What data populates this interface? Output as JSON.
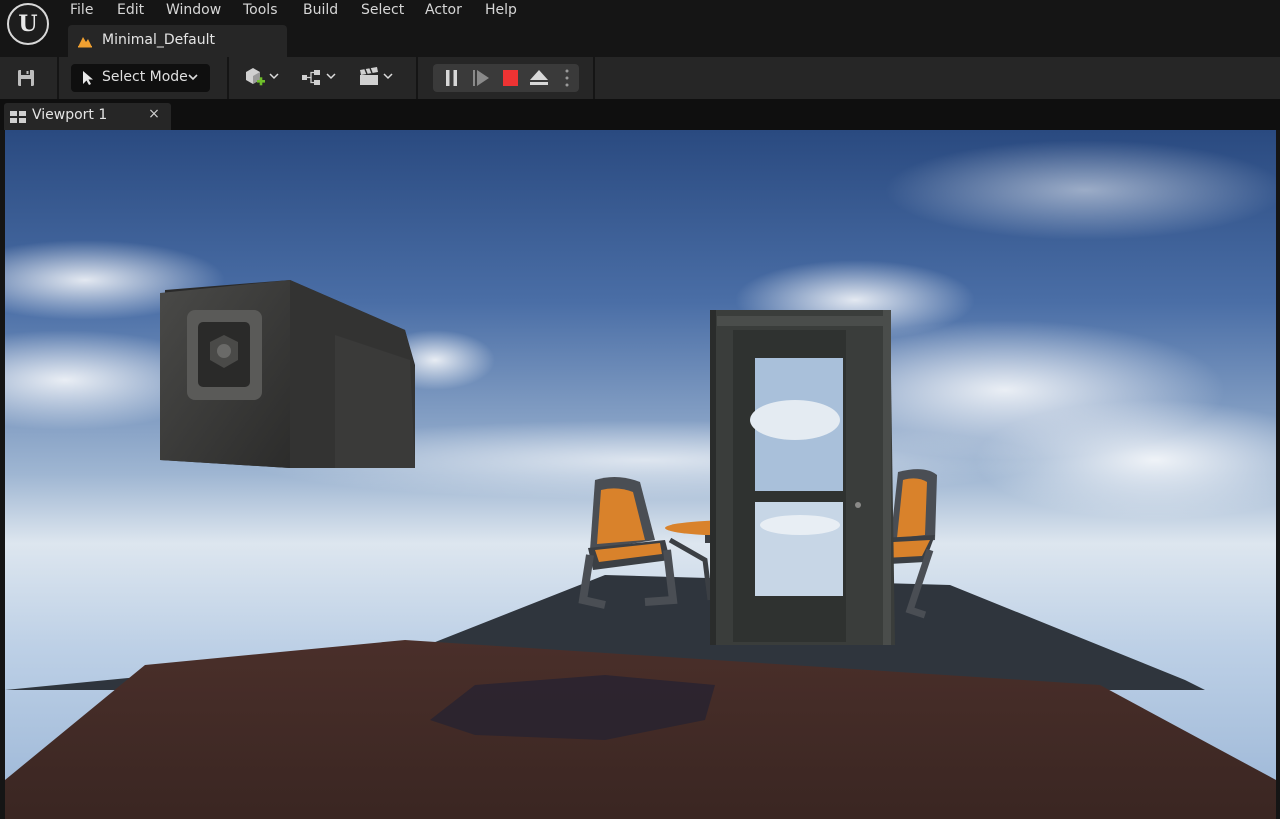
{
  "app": {
    "logo_icon": "unreal-engine-logo-icon",
    "logo_glyph": "U"
  },
  "menu": {
    "items": [
      {
        "label": "File"
      },
      {
        "label": "Edit"
      },
      {
        "label": "Window"
      },
      {
        "label": "Tools"
      },
      {
        "label": "Build"
      },
      {
        "label": "Select"
      },
      {
        "label": "Actor"
      },
      {
        "label": "Help"
      }
    ]
  },
  "document_tab": {
    "label": "Minimal_Default",
    "icon": "level-icon",
    "icon_color": "#f0a030"
  },
  "toolbar": {
    "save_icon": "save-icon",
    "mode_label": "Select Mode",
    "mode_icon": "cursor-icon",
    "add_actor_icon": "add-actor-icon",
    "add_accent_color": "#6fbf2a",
    "blueprints_icon": "blueprint-icon",
    "cinematics_icon": "clapperboard-icon",
    "play_controls": {
      "pause_icon": "pause-icon",
      "step_icon": "skip-frame-icon",
      "stop_icon": "stop-icon",
      "stop_color": "#ee3333",
      "eject_icon": "eject-icon",
      "options_icon": "more-vertical-icon"
    }
  },
  "viewport_tab": {
    "label": "Viewport 1",
    "icon": "viewport-layout-icon",
    "close_glyph": "×"
  },
  "viewport": {
    "scene": "3d-scene",
    "sky_top": "#2a4a80",
    "sky_horizon": "#dde6ef",
    "floor_color": "#3d2723",
    "chair_accent": "#d9822b"
  }
}
